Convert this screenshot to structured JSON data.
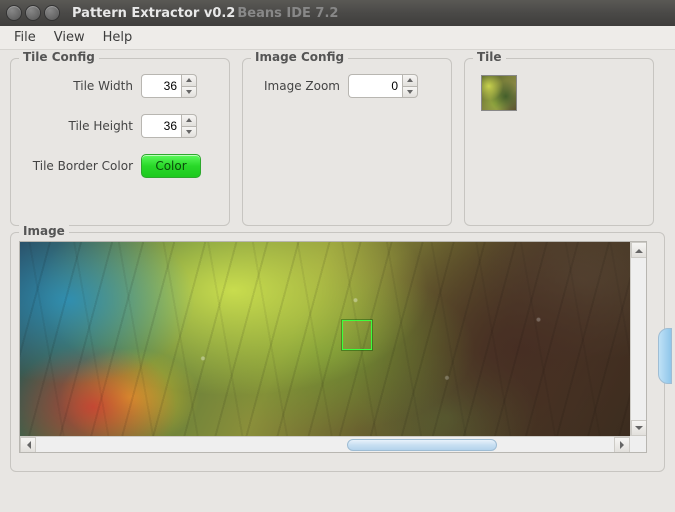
{
  "window": {
    "title": "Pattern Extractor v0.2",
    "ghost_title": "Beans IDE 7.2"
  },
  "menu": {
    "file": "File",
    "view": "View",
    "help": "Help"
  },
  "tile_config": {
    "title": "Tile Config",
    "width_label": "Tile Width",
    "width_value": "36",
    "height_label": "Tile Height",
    "height_value": "36",
    "border_label": "Tile Border Color",
    "color_button": "Color",
    "color_hex": "#29d829"
  },
  "image_config": {
    "title": "Image Config",
    "zoom_label": "Image Zoom",
    "zoom_value": "0"
  },
  "tile_panel": {
    "title": "Tile"
  },
  "image_panel": {
    "title": "Image"
  }
}
